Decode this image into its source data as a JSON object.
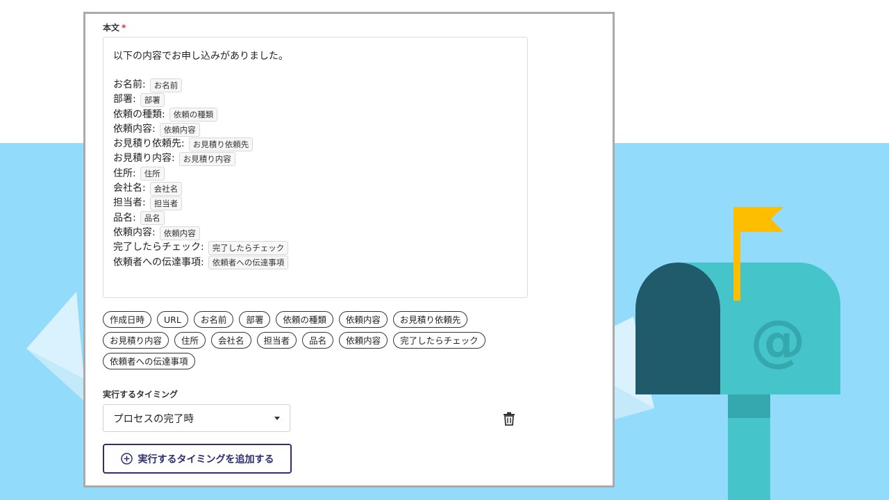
{
  "form": {
    "body_label": "本文",
    "required_mark": "*",
    "body_intro": "以下の内容でお申し込みがありました。",
    "body_lines": [
      {
        "label": "お名前:",
        "token": "お名前"
      },
      {
        "label": "部署:",
        "token": "部署"
      },
      {
        "label": "依頼の種類:",
        "token": "依頼の種類"
      },
      {
        "label": "依頼内容:",
        "token": "依頼内容"
      },
      {
        "label": "お見積り依頼先:",
        "token": "お見積り依頼先"
      },
      {
        "label": "お見積り内容:",
        "token": "お見積り内容"
      },
      {
        "label": "住所:",
        "token": "住所"
      },
      {
        "label": "会社名:",
        "token": "会社名"
      },
      {
        "label": "担当者:",
        "token": "担当者"
      },
      {
        "label": "品名:",
        "token": "品名"
      },
      {
        "label": "依頼内容:",
        "token": "依頼内容"
      },
      {
        "label": "完了したらチェック:",
        "token": "完了したらチェック"
      },
      {
        "label": "依頼者への伝達事項:",
        "token": "依頼者への伝達事項"
      }
    ],
    "variable_chips": [
      "作成日時",
      "URL",
      "お名前",
      "部署",
      "依頼の種類",
      "依頼内容",
      "お見積り依頼先",
      "お見積り内容",
      "住所",
      "会社名",
      "担当者",
      "品名",
      "依頼内容",
      "完了したらチェック",
      "依頼者への伝達事項"
    ],
    "timing_label": "実行するタイミング",
    "timing_value": "プロセスの完了時",
    "delete_icon": "trash-icon",
    "add_timing_label": "実行するタイミングを追加する",
    "add_icon": "plus-circle-icon"
  },
  "illustration": {
    "sky_color": "#93dbfa",
    "mailbox_color": "#45c4c9",
    "mailbox_door_color": "#1f5b6b",
    "flag_color": "#fdbd00",
    "mailbox_symbol": "@"
  }
}
